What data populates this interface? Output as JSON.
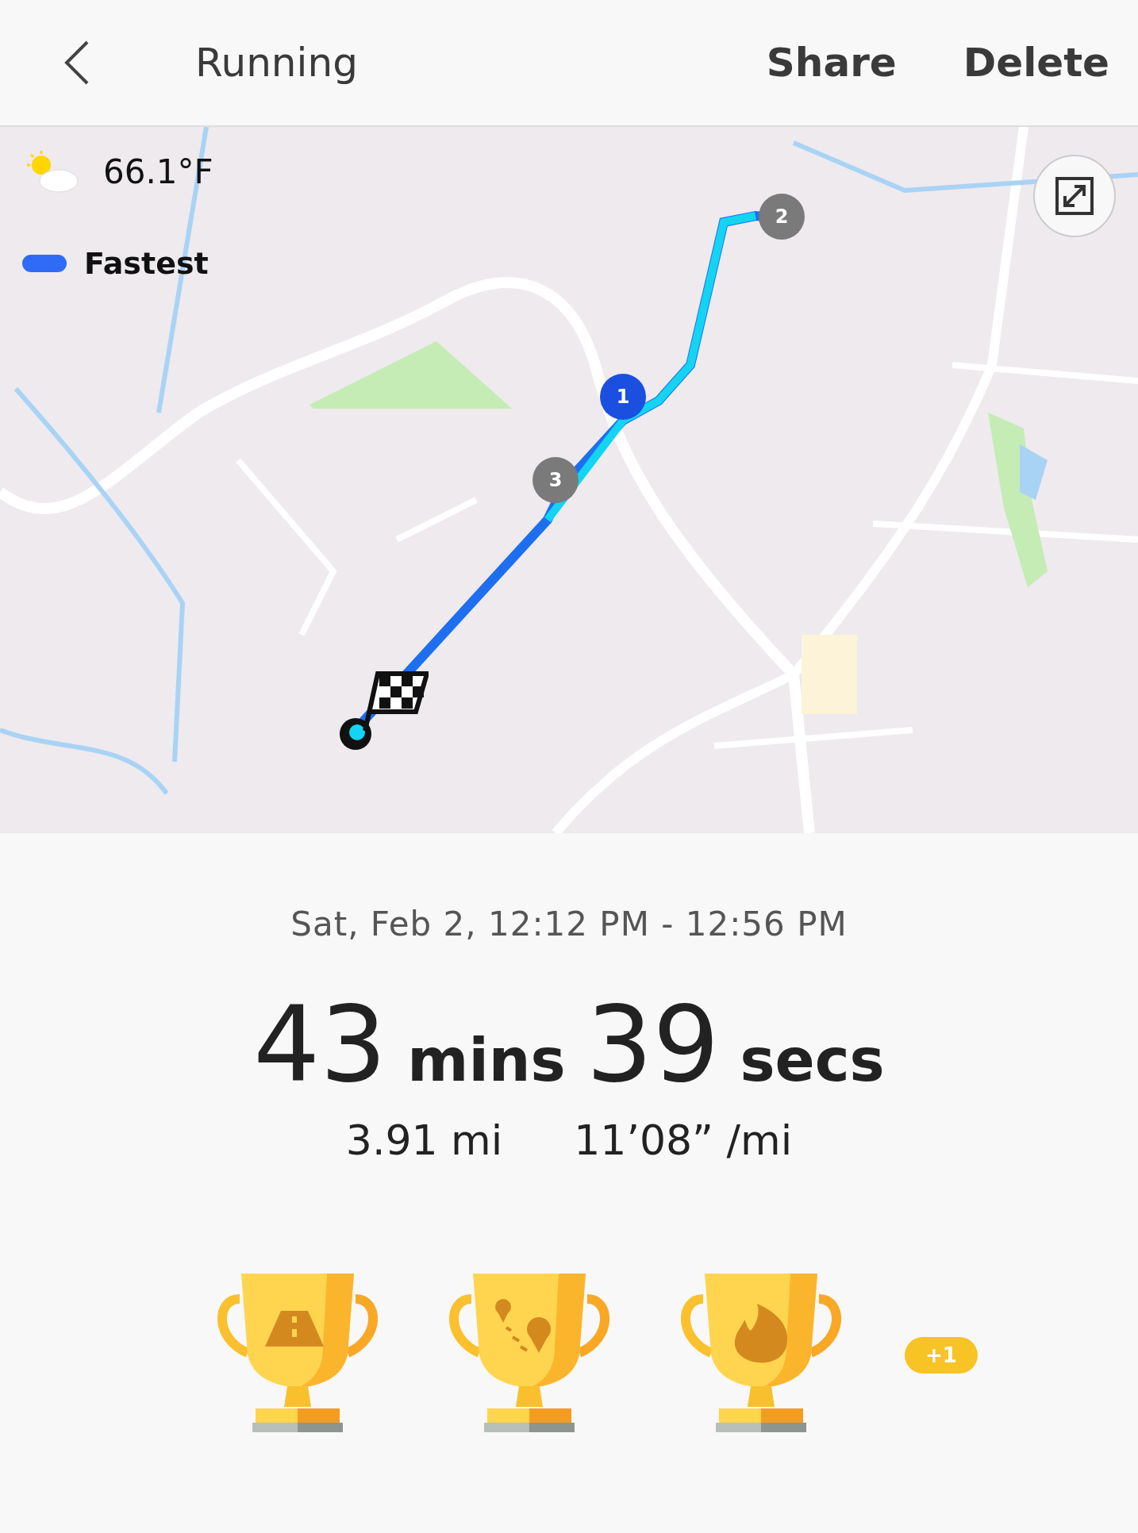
{
  "header": {
    "title": "Running",
    "actions": [
      "Share",
      "Delete"
    ]
  },
  "map": {
    "weather": "66.1°F",
    "legend": {
      "label": "Fastest",
      "color": "#2f6bf5"
    },
    "route_markers": [
      {
        "label": "1",
        "color": "#1a4fe0"
      },
      {
        "label": "2",
        "color": "#7a7a7a"
      },
      {
        "label": "3",
        "color": "#7a7a7a"
      }
    ]
  },
  "time_range": "Sat, Feb 2, 12:12 PM - 12:56 PM",
  "duration": [
    {
      "value": "43",
      "unit": "mins"
    },
    {
      "value": "39",
      "unit": "secs"
    }
  ],
  "stats": [
    "3.91 mi",
    "11’08” /mi"
  ],
  "trophies": [
    {
      "kind": "road"
    },
    {
      "kind": "route"
    },
    {
      "kind": "fire"
    }
  ],
  "more_badge": "+1"
}
